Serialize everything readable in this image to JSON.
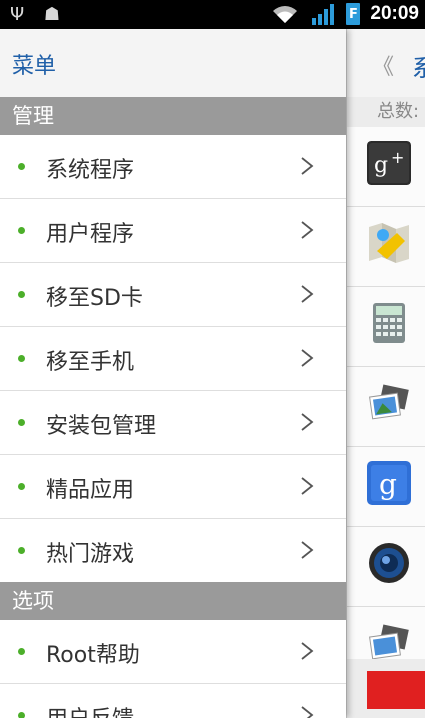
{
  "status_bar": {
    "time": "20:09",
    "battery_label": "F"
  },
  "drawer": {
    "title": "菜单",
    "sections": [
      {
        "title": "管理",
        "items": [
          "系统程序",
          "用户程序",
          "移至SD卡",
          "移至手机",
          "安装包管理",
          "精品应用",
          "热门游戏"
        ]
      },
      {
        "title": "选项",
        "items": [
          "Root帮助",
          "用户反馈"
        ]
      }
    ]
  },
  "background": {
    "back_glyph": "《",
    "title_partial": "系",
    "count_label": "总数:",
    "apps": [
      "google-plus-icon",
      "maps-icon",
      "calculator-icon",
      "gallery-icon",
      "google-search-icon",
      "music-icon",
      "gallery-icon"
    ]
  },
  "colors": {
    "accent_blue": "#1f5fa8",
    "bullet_green": "#4caf2a",
    "section_gray": "#9a9a9a"
  }
}
